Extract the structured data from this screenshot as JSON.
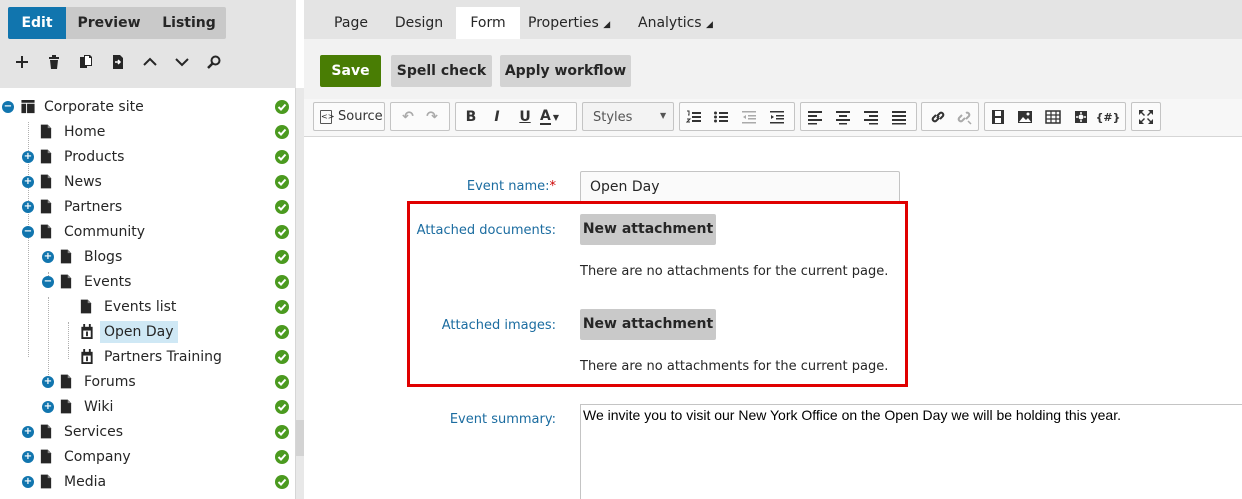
{
  "modes": [
    "Edit",
    "Preview",
    "Listing"
  ],
  "tree_toolbar": [
    "add-icon",
    "delete-icon",
    "copy-icon",
    "move-icon",
    "up-icon",
    "down-icon",
    "search-icon"
  ],
  "tree": [
    {
      "label": "Corporate site",
      "exp": "-",
      "icon": "site"
    },
    {
      "label": "Home",
      "exp": "",
      "icon": "doc"
    },
    {
      "label": "Products",
      "exp": "+",
      "icon": "doc"
    },
    {
      "label": "News",
      "exp": "+",
      "icon": "doc"
    },
    {
      "label": "Partners",
      "exp": "+",
      "icon": "doc"
    },
    {
      "label": "Community",
      "exp": "-",
      "icon": "doc"
    },
    {
      "label": "Blogs",
      "exp": "+",
      "icon": "doc"
    },
    {
      "label": "Events",
      "exp": "-",
      "icon": "doc"
    },
    {
      "label": "Events list",
      "exp": "",
      "icon": "doc"
    },
    {
      "label": "Open Day",
      "exp": "",
      "icon": "event",
      "selected": true
    },
    {
      "label": "Partners Training",
      "exp": "",
      "icon": "event"
    },
    {
      "label": "Forums",
      "exp": "+",
      "icon": "doc"
    },
    {
      "label": "Wiki",
      "exp": "+",
      "icon": "doc"
    },
    {
      "label": "Services",
      "exp": "+",
      "icon": "doc"
    },
    {
      "label": "Company",
      "exp": "+",
      "icon": "doc"
    },
    {
      "label": "Media",
      "exp": "+",
      "icon": "doc"
    }
  ],
  "top_tabs": [
    "Page",
    "Design",
    "Form",
    "Properties",
    "Analytics"
  ],
  "actions": {
    "save": "Save",
    "spell_check": "Spell check",
    "apply_workflow": "Apply workflow"
  },
  "editor": {
    "source": "Source",
    "styles": "Styles",
    "bold": "B",
    "italic": "I",
    "underline": "U",
    "font_color": "A",
    "placeholder_btn": "{#}"
  },
  "form": {
    "event_name_label": "Event name:",
    "required_mark": "*",
    "event_name_value": "Open Day",
    "attached_documents_label": "Attached documents:",
    "attached_images_label": "Attached images:",
    "new_attachment": "New attachment",
    "no_attachments": "There are no attachments for the current page.",
    "event_summary_label": "Event summary:",
    "event_summary_value": "We invite you to visit our New York Office on the Open Day we will be holding this year."
  },
  "colors": {
    "accent": "#1175ae",
    "save": "#497d04",
    "highlight": "#e00000",
    "check": "#4b9a1f"
  }
}
